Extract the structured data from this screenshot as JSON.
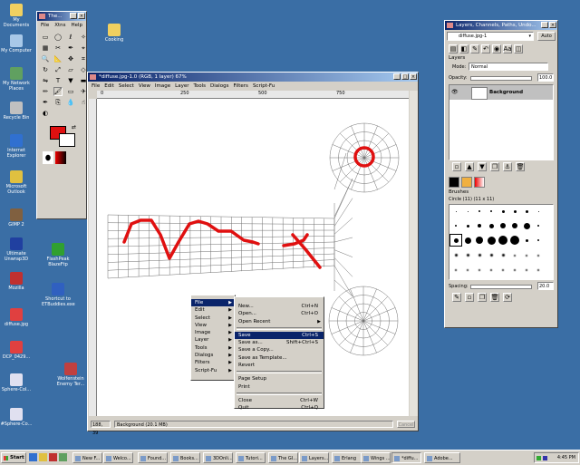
{
  "desktop": {
    "icons": [
      {
        "label": "My Documents",
        "color": "#f0d060"
      },
      {
        "label": "My Computer",
        "color": "#a8c8e8"
      },
      {
        "label": "My Network Places",
        "color": "#60a060"
      },
      {
        "label": "Recycle Bin",
        "color": "#c0c0c0"
      },
      {
        "label": "Internet Explorer",
        "color": "#3070d0"
      },
      {
        "label": "Microsoft Outlook",
        "color": "#e0c040"
      },
      {
        "label": "GIMP 2",
        "color": "#806040"
      },
      {
        "label": "Ultimate Unwrap3D",
        "color": "#2040a0"
      },
      {
        "label": "Mozilla",
        "color": "#c03030"
      },
      {
        "label": "diffuse.jpg",
        "color": "#e04040"
      },
      {
        "label": "DCP_0429...",
        "color": "#e04040"
      },
      {
        "label": "Sphere-Col...",
        "color": "#e0e0f0"
      },
      {
        "label": "#Sphere-Co...",
        "color": "#e0e0f0"
      }
    ],
    "icons2": [
      {
        "label": "FlashPeak BlazeFtp",
        "color": "#30a030"
      },
      {
        "label": "Shortcut to ETBuddies.exe",
        "color": "#3060c0"
      },
      {
        "label": "Wolfenstein Enemy Ter...",
        "color": "#c04040"
      }
    ],
    "cooking_label": "Cooking"
  },
  "toolbox": {
    "title": "The...",
    "menu": [
      "File",
      "Xtns",
      "Help"
    ]
  },
  "image_window": {
    "title": "*diffuse.jpg-1.0 (RGB, 1 layer) 67%",
    "menu": [
      "File",
      "Edit",
      "Select",
      "View",
      "Image",
      "Layer",
      "Tools",
      "Dialogs",
      "Filters",
      "Script-Fu"
    ],
    "ruler_marks": [
      "0",
      "250",
      "500",
      "750"
    ],
    "status_coords": "188, 39",
    "status_text": "Background (20.1 MB)",
    "cancel_label": "Cancel"
  },
  "context_menu": {
    "items": [
      "File",
      "Edit",
      "Select",
      "View",
      "Image",
      "Layer",
      "Tools",
      "Dialogs",
      "Filters",
      "Script-Fu"
    ]
  },
  "file_submenu": {
    "new": "New...",
    "new_sc": "Ctrl+N",
    "open": "Open...",
    "open_sc": "Ctrl+O",
    "open_recent": "Open Recent",
    "save": "Save",
    "save_sc": "Ctrl+S",
    "save_as": "Save as...",
    "save_as_sc": "Shift+Ctrl+S",
    "save_copy": "Save a Copy...",
    "save_template": "Save as Template...",
    "revert": "Revert",
    "page_setup": "Page Setup",
    "print": "Print",
    "close": "Close",
    "close_sc": "Ctrl+W",
    "quit": "Quit",
    "quit_sc": "Ctrl+Q"
  },
  "layers_window": {
    "title": "Layers, Channels, Paths, Undo...",
    "image_select": "diffuse.jpg-1",
    "auto_label": "Auto",
    "section_label": "Layers",
    "mode_label": "Mode:",
    "mode_value": "Normal",
    "opacity_label": "Opacity:",
    "opacity_value": "100.0",
    "layer_name": "Background"
  },
  "brushes": {
    "section_label": "Brushes",
    "current": "Circle (11) (11 x 11)",
    "spacing_label": "Spacing:",
    "spacing_value": "20.0"
  },
  "taskbar": {
    "start_label": "Start",
    "buttons": [
      "New F...",
      "Welco...",
      "Found...",
      "Books...",
      "3DOnli...",
      "Tutori...",
      "The GI...",
      "Layers...",
      "Erlang",
      "Wings ...",
      "*diffu...",
      "Adobe..."
    ],
    "clock": "4:45 PM"
  },
  "colors": {
    "desktop": "#3a6ea5",
    "taskbar": "#d4d0c8",
    "title_active": "#0a246a",
    "paint": "#e01010"
  }
}
